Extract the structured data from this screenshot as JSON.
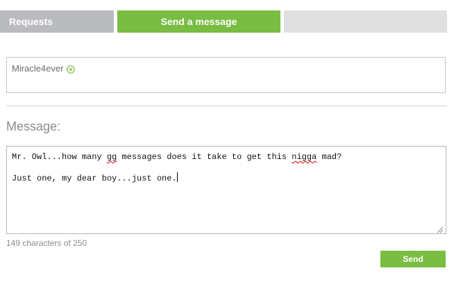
{
  "tabs": {
    "requests_label": "Requests",
    "send_label": "Send a message"
  },
  "recipients": {
    "token_name": "Miracle4ever",
    "remove_icon": "circle-x-icon"
  },
  "message": {
    "label": "Message:",
    "line1_before": "Mr. Owl...how many ",
    "line1_word1": "gg",
    "line1_mid": " messages does it take to get this ",
    "line1_word2": "nigga",
    "line1_after": " mad?",
    "line2": "Just one, my dear boy...just one."
  },
  "char_count": "149 characters of 250",
  "send_label": "Send",
  "colors": {
    "accent": "#79bd42",
    "tab_inactive": "#b9bbbe",
    "tab_empty": "#e0e0e1"
  }
}
